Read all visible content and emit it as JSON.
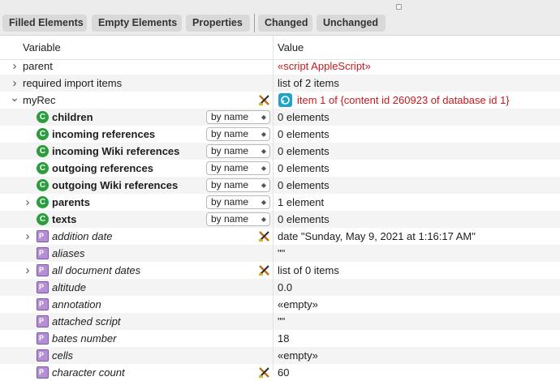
{
  "toolbar": {
    "buttons": [
      "Filled Elements",
      "Empty Elements",
      "Properties",
      "Changed",
      "Unchanged"
    ]
  },
  "columns": {
    "variable": "Variable",
    "value": "Value"
  },
  "rows": [
    {
      "name": "parent",
      "value": "«script AppleScript»",
      "icon": "none",
      "expander": "chevron-right-icon",
      "value_color": "#c8191e"
    },
    {
      "name": "required import items",
      "value": "list of 2 items",
      "icon": "none",
      "expander": "chevron-right-icon"
    },
    {
      "name": "myRec",
      "value": "item 1 of {content id 260923 of database id 1}",
      "icon": "none",
      "expander": "chevron-down-icon",
      "value_color": "#c8191e",
      "value_icon": "reference-icon",
      "marker": "edit-marker-icon"
    },
    {
      "name": "children",
      "value": "0 elements",
      "icon": "class-icon",
      "icon_letter": "C",
      "selector": "by name"
    },
    {
      "name": "incoming references",
      "value": "0 elements",
      "icon": "class-icon",
      "icon_letter": "C",
      "selector": "by name"
    },
    {
      "name": "incoming Wiki references",
      "value": "0 elements",
      "icon": "class-icon",
      "icon_letter": "C",
      "selector": "by name"
    },
    {
      "name": "outgoing references",
      "value": "0 elements",
      "icon": "class-icon",
      "icon_letter": "C",
      "selector": "by name"
    },
    {
      "name": "outgoing Wiki references",
      "value": "0 elements",
      "icon": "class-icon",
      "icon_letter": "C",
      "selector": "by name"
    },
    {
      "name": "parents",
      "value": "1 element",
      "icon": "class-icon",
      "icon_letter": "C",
      "selector": "by name",
      "expander": "chevron-right-icon"
    },
    {
      "name": "texts",
      "value": "0 elements",
      "icon": "class-icon",
      "icon_letter": "C",
      "selector": "by name"
    },
    {
      "name": "addition date",
      "value": "date \"Sunday, May 9, 2021 at 1:16:17 AM\"",
      "icon": "property-icon",
      "expander": "chevron-right-icon",
      "marker": "edit-marker-icon"
    },
    {
      "name": "aliases",
      "value": "\"\"",
      "icon": "property-icon"
    },
    {
      "name": "all document dates",
      "value": "list of 0 items",
      "icon": "property-icon",
      "expander": "chevron-right-icon",
      "marker": "edit-marker-icon"
    },
    {
      "name": "altitude",
      "value": "0.0",
      "icon": "property-icon"
    },
    {
      "name": "annotation",
      "value": "«empty»",
      "icon": "property-icon"
    },
    {
      "name": "attached script",
      "value": "\"\"",
      "icon": "property-icon"
    },
    {
      "name": "bates number",
      "value": "18",
      "icon": "property-icon"
    },
    {
      "name": "cells",
      "value": "«empty»",
      "icon": "property-icon"
    },
    {
      "name": "character count",
      "value": "60",
      "icon": "property-icon",
      "marker": "edit-marker-icon"
    }
  ]
}
